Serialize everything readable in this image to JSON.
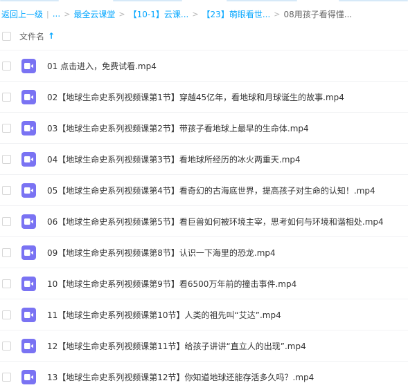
{
  "breadcrumb": {
    "back": "返回上一级",
    "ellipsis": "...",
    "items": [
      "最全云课堂",
      "【10-1】云课...",
      "【23】萌眼看世..."
    ],
    "current": "08用孩子看得懂..."
  },
  "header": {
    "column_name": "文件名"
  },
  "colors": {
    "accent": "#06a7ff",
    "video_icon": "#7a73f3"
  },
  "files": [
    {
      "name": "01 点击进入，免费试看.mp4",
      "icon": "video-icon"
    },
    {
      "name": "02【地球生命史系列视频课第1节】穿越45亿年，看地球和月球诞生的故事.mp4",
      "icon": "video-icon"
    },
    {
      "name": "03【地球生命史系列视频课第2节】带孩子看地球上最早的生命体.mp4",
      "icon": "video-icon"
    },
    {
      "name": "04【地球生命史系列视频课第3节】看地球所经历的冰火两重天.mp4",
      "icon": "video-icon"
    },
    {
      "name": "05【地球生命史系列视频课第4节】看奇幻的古海底世界，提高孩子对生命的认知！.mp4",
      "icon": "video-icon"
    },
    {
      "name": "06【地球生命史系列视频课第5节】看巨兽如何被环境主宰，思考如何与环境和谐相处.mp4",
      "icon": "video-icon"
    },
    {
      "name": "09【地球生命史系列视频课第8节】认识一下海里的恐龙.mp4",
      "icon": "video-icon"
    },
    {
      "name": "10【地球生命史系列视频课第9节】看6500万年前的撞击事件.mp4",
      "icon": "video-icon"
    },
    {
      "name": "11【地球生命史系列视频课第10节】人类的祖先叫“艾达”.mp4",
      "icon": "video-icon"
    },
    {
      "name": "12【地球生命史系列视频课第11节】给孩子讲讲“直立人的出现”.mp4",
      "icon": "video-icon"
    },
    {
      "name": "13【地球生命史系列视频课第12节】你知道地球还能存活多久吗？.mp4",
      "icon": "video-icon"
    }
  ]
}
